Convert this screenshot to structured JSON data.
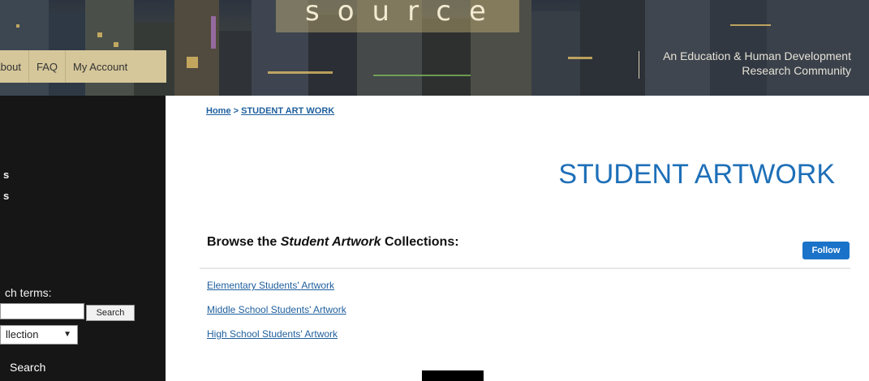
{
  "banner": {
    "logo_text": "source",
    "tagline_line1": "An Education & Human Development",
    "tagline_line2": "Research Community"
  },
  "nav": {
    "items": [
      "About",
      "FAQ",
      "My Account"
    ]
  },
  "sidebar": {
    "truncated_1": "s",
    "truncated_2": "s",
    "search_terms_label": "ch terms:",
    "search_button": "Search",
    "scope_select_value": "llection",
    "advanced_search": "Search"
  },
  "breadcrumb": {
    "home": "Home",
    "separator": ">",
    "current": "STUDENT ART WORK"
  },
  "main": {
    "title": "STUDENT ARTWORK",
    "browse_prefix": "Browse the ",
    "browse_italic": "Student Artwork",
    "browse_suffix": " Collections:",
    "follow_button": "Follow",
    "collections": [
      "Elementary Students' Artwork",
      "Middle School Students' Artwork",
      "High School Students' Artwork"
    ]
  },
  "colors": {
    "nav_bg": "#d5c79a",
    "sidebar_bg": "#161616",
    "link": "#1f5f9e",
    "title": "#1e6fb8",
    "follow_bg": "#1a73c8"
  }
}
